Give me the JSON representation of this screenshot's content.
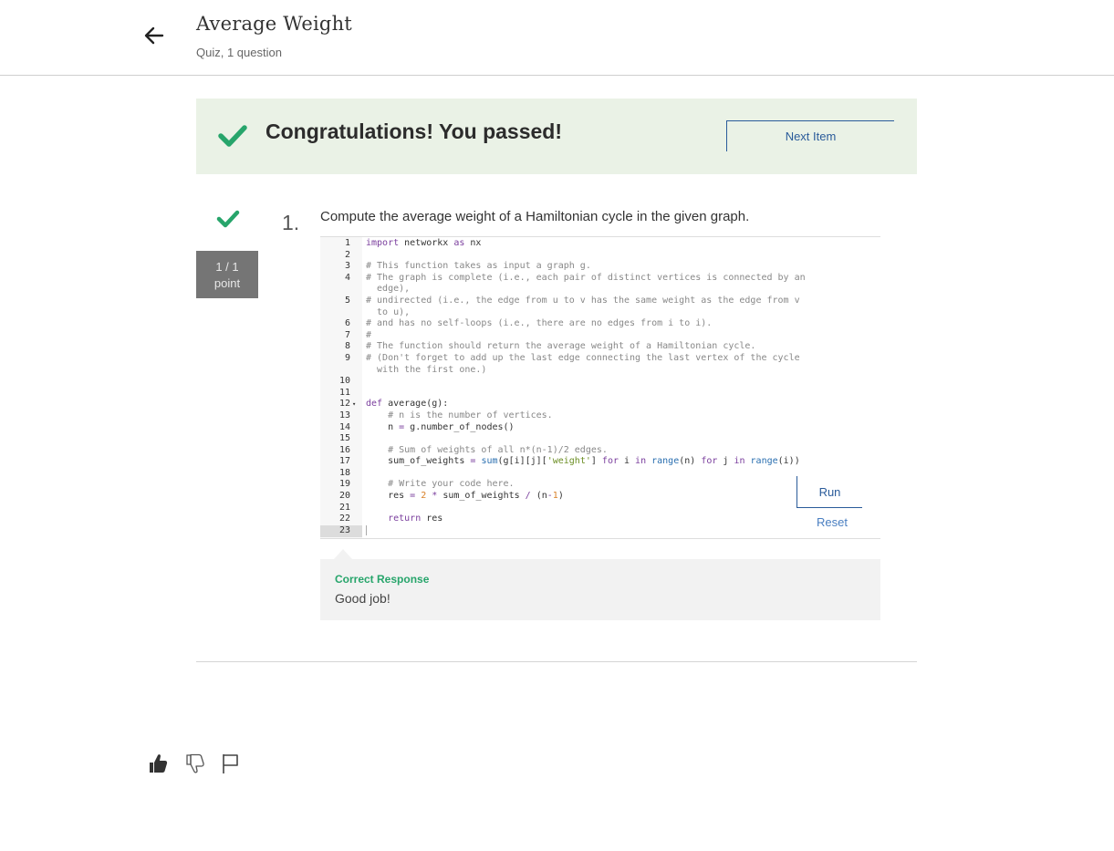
{
  "header": {
    "title": "Average Weight",
    "subtitle": "Quiz, 1 question",
    "back_icon": "arrow-left-icon"
  },
  "banner": {
    "message": "Congratulations! You passed!",
    "next_label": "Next Item",
    "check_color": "#27a56b"
  },
  "question": {
    "number": "1.",
    "text": "Compute the average weight of a Hamiltonian cycle in the given graph.",
    "points_line1": "1 / 1",
    "points_line2": "point"
  },
  "editor": {
    "lines": [
      {
        "n": "1",
        "src": "import networkx as nx"
      },
      {
        "n": "2",
        "src": ""
      },
      {
        "n": "3",
        "src": "# This function takes as input a graph g."
      },
      {
        "n": "4",
        "src": "# The graph is complete (i.e., each pair of distinct vertices is connected by an"
      },
      {
        "n": "",
        "src": "  edge),"
      },
      {
        "n": "5",
        "src": "# undirected (i.e., the edge from u to v has the same weight as the edge from v"
      },
      {
        "n": "",
        "src": "  to u),"
      },
      {
        "n": "6",
        "src": "# and has no self-loops (i.e., there are no edges from i to i)."
      },
      {
        "n": "7",
        "src": "#"
      },
      {
        "n": "8",
        "src": "# The function should return the average weight of a Hamiltonian cycle."
      },
      {
        "n": "9",
        "src": "# (Don't forget to add up the last edge connecting the last vertex of the cycle"
      },
      {
        "n": "",
        "src": "  with the first one.)"
      },
      {
        "n": "10",
        "src": ""
      },
      {
        "n": "11",
        "src": ""
      },
      {
        "n": "12",
        "src": "def average(g):"
      },
      {
        "n": "13",
        "src": "    # n is the number of vertices."
      },
      {
        "n": "14",
        "src": "    n = g.number_of_nodes()"
      },
      {
        "n": "15",
        "src": ""
      },
      {
        "n": "16",
        "src": "    # Sum of weights of all n*(n-1)/2 edges."
      },
      {
        "n": "17",
        "src": "    sum_of_weights = sum(g[i][j]['weight'] for i in range(n) for j in range(i))"
      },
      {
        "n": "18",
        "src": ""
      },
      {
        "n": "19",
        "src": "    # Write your code here."
      },
      {
        "n": "20",
        "src": "    res = 2 * sum_of_weights / (n-1)"
      },
      {
        "n": "21",
        "src": ""
      },
      {
        "n": "22",
        "src": "    return res"
      },
      {
        "n": "23",
        "src": ""
      }
    ],
    "fold_marker": "▾",
    "run_label": "Run",
    "reset_label": "Reset"
  },
  "feedback": {
    "title": "Correct Response",
    "text": "Good job!"
  },
  "footer": {
    "icons": [
      "thumbs-up-icon",
      "thumbs-down-icon",
      "flag-icon"
    ]
  }
}
